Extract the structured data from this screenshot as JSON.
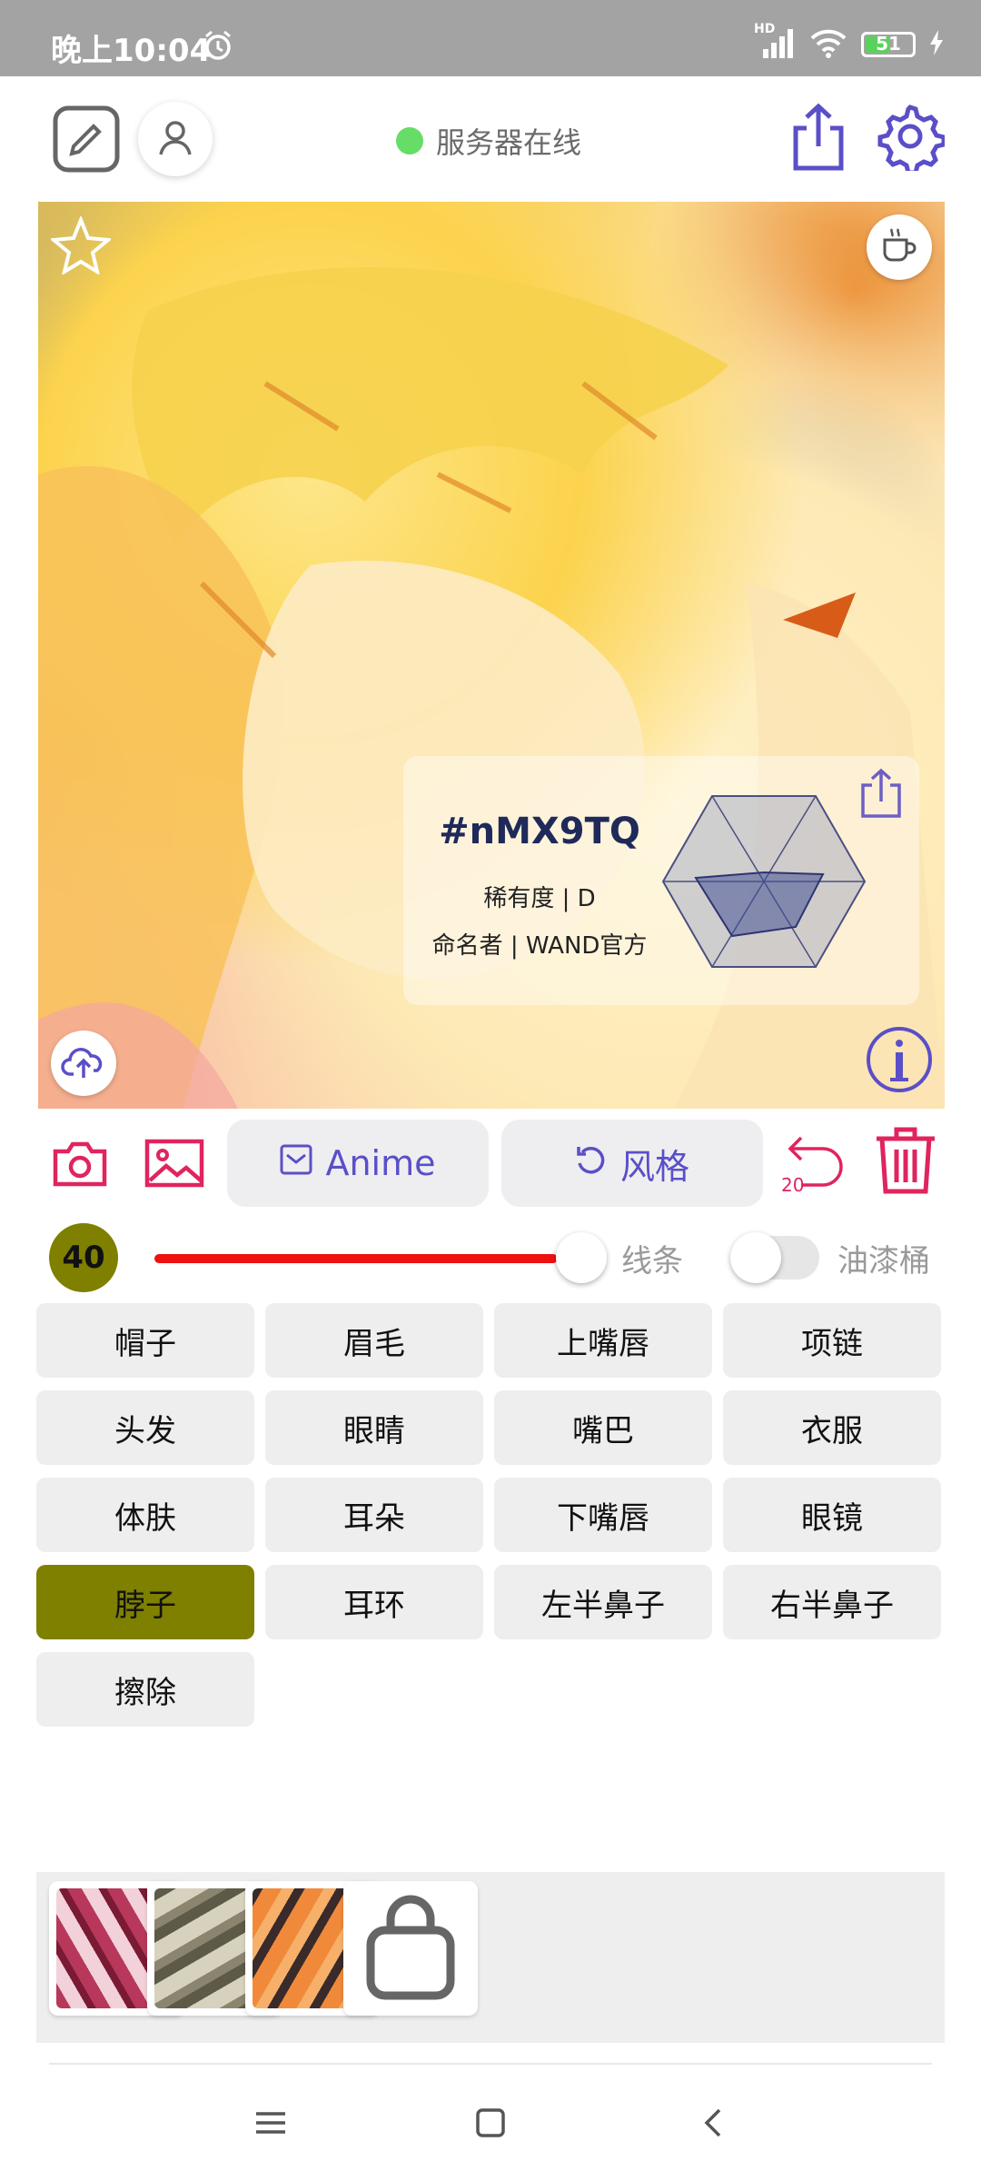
{
  "status_bar": {
    "time": "晚上10:04",
    "network_label": "HD",
    "battery_level": "51",
    "battery_fraction": 0.51
  },
  "header": {
    "server_status": "服务器在线",
    "server_status_color": "#66dd66"
  },
  "artwork": {
    "code": "#nMX9TQ",
    "rarity": "稀有度 | D",
    "namer": "命名者 | WAND官方"
  },
  "toolbar": {
    "anime_label": "Anime",
    "style_label": "风格",
    "undo_count": "20",
    "accent_color": "#5a4fc8",
    "danger_color": "#e0245e"
  },
  "brush": {
    "size": "40",
    "line_label": "线条",
    "bucket_label": "油漆桶",
    "line_slider_fraction": 0.8
  },
  "parts": [
    {
      "label": "帽子",
      "active": false
    },
    {
      "label": "眉毛",
      "active": false
    },
    {
      "label": "上嘴唇",
      "active": false
    },
    {
      "label": "项链",
      "active": false
    },
    {
      "label": "头发",
      "active": false
    },
    {
      "label": "眼睛",
      "active": false
    },
    {
      "label": "嘴巴",
      "active": false
    },
    {
      "label": "衣服",
      "active": false
    },
    {
      "label": "体肤",
      "active": false
    },
    {
      "label": "耳朵",
      "active": false
    },
    {
      "label": "下嘴唇",
      "active": false
    },
    {
      "label": "眼镜",
      "active": false
    },
    {
      "label": "脖子",
      "active": true
    },
    {
      "label": "耳环",
      "active": false
    },
    {
      "label": "左半鼻子",
      "active": false
    },
    {
      "label": "右半鼻子",
      "active": false
    },
    {
      "label": "擦除",
      "active": false
    }
  ]
}
